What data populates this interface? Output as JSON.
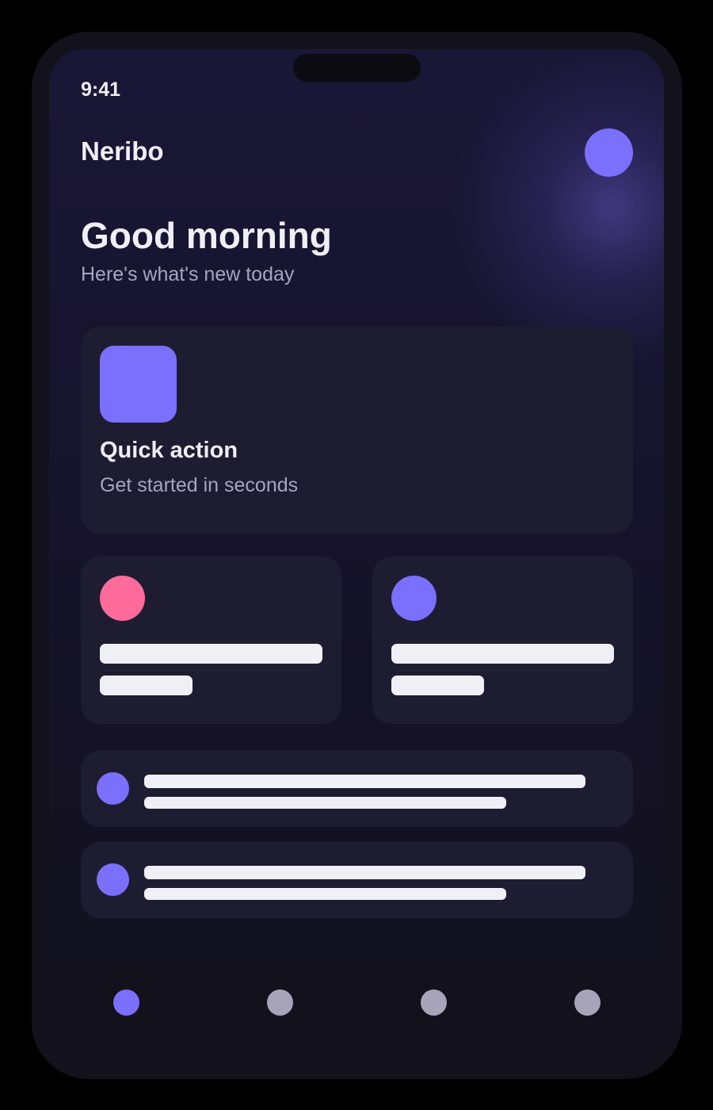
{
  "status_bar": {
    "time": "9:41"
  },
  "header": {
    "brand": "Neribo",
    "avatar_icon": "avatar-circle"
  },
  "hero": {
    "greeting": "Good morning",
    "subtitle": "Here's what's new today"
  },
  "quick_action": {
    "title": "Quick action",
    "subtitle": "Get started in seconds",
    "icon": "quick-action-icon"
  },
  "tiles": [
    {
      "icon": "pink-dot-icon",
      "color": "#ff6b9b"
    },
    {
      "icon": "purple-dot-icon",
      "color": "#7b6ffd"
    }
  ],
  "list": [
    {
      "icon": "list-dot-icon"
    },
    {
      "icon": "list-dot-icon"
    }
  ],
  "bottom_nav": {
    "items": [
      {
        "icon": "nav-home-icon",
        "active": true
      },
      {
        "icon": "nav-item-2-icon",
        "active": false
      },
      {
        "icon": "nav-item-3-icon",
        "active": false
      },
      {
        "icon": "nav-item-4-icon",
        "active": false
      }
    ]
  },
  "colors": {
    "accent": "#7b6ffd",
    "pink": "#ff6b9b",
    "card": "#1e1c31",
    "text": "#f0eff6",
    "muted": "#a8a4bd"
  }
}
